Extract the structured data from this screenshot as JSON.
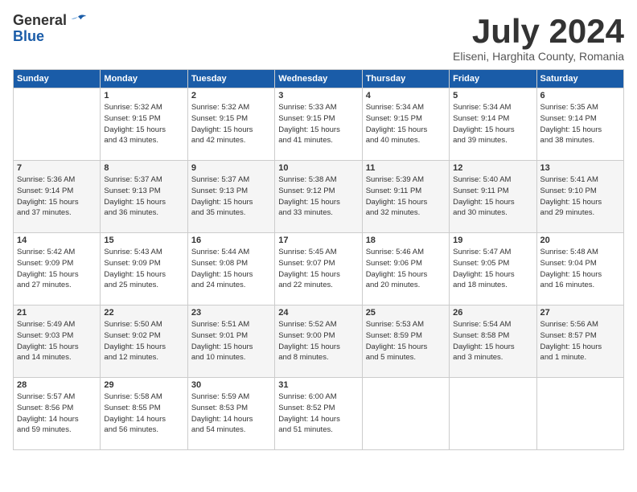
{
  "header": {
    "logo_general": "General",
    "logo_blue": "Blue",
    "month": "July 2024",
    "location": "Eliseni, Harghita County, Romania"
  },
  "weekdays": [
    "Sunday",
    "Monday",
    "Tuesday",
    "Wednesday",
    "Thursday",
    "Friday",
    "Saturday"
  ],
  "weeks": [
    [
      {
        "day": "",
        "info": ""
      },
      {
        "day": "1",
        "info": "Sunrise: 5:32 AM\nSunset: 9:15 PM\nDaylight: 15 hours\nand 43 minutes."
      },
      {
        "day": "2",
        "info": "Sunrise: 5:32 AM\nSunset: 9:15 PM\nDaylight: 15 hours\nand 42 minutes."
      },
      {
        "day": "3",
        "info": "Sunrise: 5:33 AM\nSunset: 9:15 PM\nDaylight: 15 hours\nand 41 minutes."
      },
      {
        "day": "4",
        "info": "Sunrise: 5:34 AM\nSunset: 9:15 PM\nDaylight: 15 hours\nand 40 minutes."
      },
      {
        "day": "5",
        "info": "Sunrise: 5:34 AM\nSunset: 9:14 PM\nDaylight: 15 hours\nand 39 minutes."
      },
      {
        "day": "6",
        "info": "Sunrise: 5:35 AM\nSunset: 9:14 PM\nDaylight: 15 hours\nand 38 minutes."
      }
    ],
    [
      {
        "day": "7",
        "info": "Sunrise: 5:36 AM\nSunset: 9:14 PM\nDaylight: 15 hours\nand 37 minutes."
      },
      {
        "day": "8",
        "info": "Sunrise: 5:37 AM\nSunset: 9:13 PM\nDaylight: 15 hours\nand 36 minutes."
      },
      {
        "day": "9",
        "info": "Sunrise: 5:37 AM\nSunset: 9:13 PM\nDaylight: 15 hours\nand 35 minutes."
      },
      {
        "day": "10",
        "info": "Sunrise: 5:38 AM\nSunset: 9:12 PM\nDaylight: 15 hours\nand 33 minutes."
      },
      {
        "day": "11",
        "info": "Sunrise: 5:39 AM\nSunset: 9:11 PM\nDaylight: 15 hours\nand 32 minutes."
      },
      {
        "day": "12",
        "info": "Sunrise: 5:40 AM\nSunset: 9:11 PM\nDaylight: 15 hours\nand 30 minutes."
      },
      {
        "day": "13",
        "info": "Sunrise: 5:41 AM\nSunset: 9:10 PM\nDaylight: 15 hours\nand 29 minutes."
      }
    ],
    [
      {
        "day": "14",
        "info": "Sunrise: 5:42 AM\nSunset: 9:09 PM\nDaylight: 15 hours\nand 27 minutes."
      },
      {
        "day": "15",
        "info": "Sunrise: 5:43 AM\nSunset: 9:09 PM\nDaylight: 15 hours\nand 25 minutes."
      },
      {
        "day": "16",
        "info": "Sunrise: 5:44 AM\nSunset: 9:08 PM\nDaylight: 15 hours\nand 24 minutes."
      },
      {
        "day": "17",
        "info": "Sunrise: 5:45 AM\nSunset: 9:07 PM\nDaylight: 15 hours\nand 22 minutes."
      },
      {
        "day": "18",
        "info": "Sunrise: 5:46 AM\nSunset: 9:06 PM\nDaylight: 15 hours\nand 20 minutes."
      },
      {
        "day": "19",
        "info": "Sunrise: 5:47 AM\nSunset: 9:05 PM\nDaylight: 15 hours\nand 18 minutes."
      },
      {
        "day": "20",
        "info": "Sunrise: 5:48 AM\nSunset: 9:04 PM\nDaylight: 15 hours\nand 16 minutes."
      }
    ],
    [
      {
        "day": "21",
        "info": "Sunrise: 5:49 AM\nSunset: 9:03 PM\nDaylight: 15 hours\nand 14 minutes."
      },
      {
        "day": "22",
        "info": "Sunrise: 5:50 AM\nSunset: 9:02 PM\nDaylight: 15 hours\nand 12 minutes."
      },
      {
        "day": "23",
        "info": "Sunrise: 5:51 AM\nSunset: 9:01 PM\nDaylight: 15 hours\nand 10 minutes."
      },
      {
        "day": "24",
        "info": "Sunrise: 5:52 AM\nSunset: 9:00 PM\nDaylight: 15 hours\nand 8 minutes."
      },
      {
        "day": "25",
        "info": "Sunrise: 5:53 AM\nSunset: 8:59 PM\nDaylight: 15 hours\nand 5 minutes."
      },
      {
        "day": "26",
        "info": "Sunrise: 5:54 AM\nSunset: 8:58 PM\nDaylight: 15 hours\nand 3 minutes."
      },
      {
        "day": "27",
        "info": "Sunrise: 5:56 AM\nSunset: 8:57 PM\nDaylight: 15 hours\nand 1 minute."
      }
    ],
    [
      {
        "day": "28",
        "info": "Sunrise: 5:57 AM\nSunset: 8:56 PM\nDaylight: 14 hours\nand 59 minutes."
      },
      {
        "day": "29",
        "info": "Sunrise: 5:58 AM\nSunset: 8:55 PM\nDaylight: 14 hours\nand 56 minutes."
      },
      {
        "day": "30",
        "info": "Sunrise: 5:59 AM\nSunset: 8:53 PM\nDaylight: 14 hours\nand 54 minutes."
      },
      {
        "day": "31",
        "info": "Sunrise: 6:00 AM\nSunset: 8:52 PM\nDaylight: 14 hours\nand 51 minutes."
      },
      {
        "day": "",
        "info": ""
      },
      {
        "day": "",
        "info": ""
      },
      {
        "day": "",
        "info": ""
      }
    ]
  ]
}
